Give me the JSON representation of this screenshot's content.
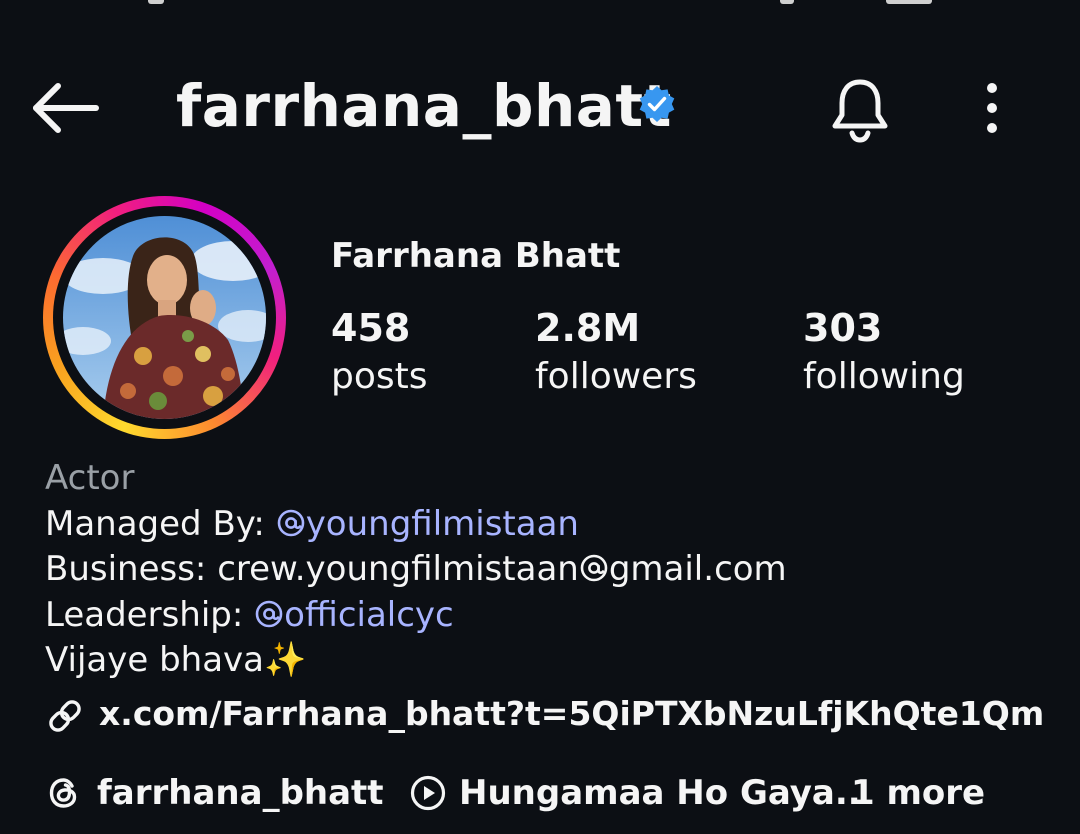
{
  "header": {
    "username": "farrhana_bhatt",
    "verified": true,
    "icons": [
      "back-arrow-icon",
      "verified-badge-icon",
      "bell-icon",
      "more-vertical-icon"
    ],
    "accent_color": "#3897f0"
  },
  "profile": {
    "display_name": "Farrhana Bhatt",
    "stats": [
      {
        "value": "458",
        "label": "posts"
      },
      {
        "value": "2.8M",
        "label": "followers"
      },
      {
        "value": "303",
        "label": "following"
      }
    ]
  },
  "bio": {
    "category": "Actor",
    "managed_prefix": "Managed By: ",
    "managed_handle": "youngfilmistaan",
    "business_prefix": "Business: crew.youngfilmistaan",
    "business_suffix": "gmail.com",
    "leadership_prefix": "Leadership: ",
    "leadership_handle": "officialcyc",
    "tagline": "Vijaye bhava✨",
    "link": "x.com/Farrhana_bhatt?t=5QiPTXbNzuLfjKhQte1Qm...",
    "mention_color": "#a8b4ff"
  },
  "chips": {
    "threads_handle": "farrhana_bhatt",
    "music": "Hungamaa Ho Gaya..",
    "more": "1 more"
  }
}
